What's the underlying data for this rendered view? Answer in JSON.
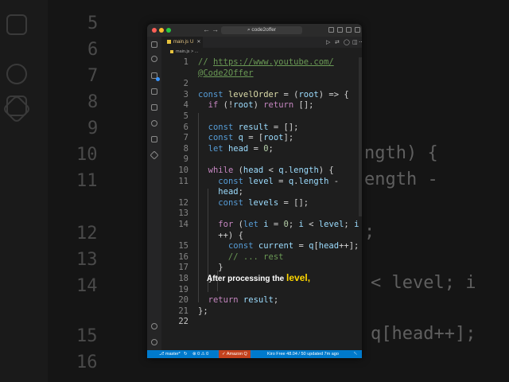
{
  "window": {
    "title": "code2offer",
    "search_text": "⌕ code2offer",
    "traffic_lights": [
      "#ff5f57",
      "#febc2e",
      "#28c840"
    ]
  },
  "tab": {
    "name": "main.js",
    "modified": "U",
    "close": "✕"
  },
  "breadcrumb": "main.js > ...",
  "editor": {
    "lines": [
      {
        "n": "1",
        "t": "// https://www.youtube.com/"
      },
      {
        "n": "",
        "t": "@Code2Offer"
      },
      {
        "n": "2",
        "t": ""
      },
      {
        "n": "3",
        "t": "const levelOrder = (root) => {"
      },
      {
        "n": "4",
        "t": "  if (!root) return [];"
      },
      {
        "n": "5",
        "t": ""
      },
      {
        "n": "6",
        "t": "  const result = [];"
      },
      {
        "n": "7",
        "t": "  const q = [root];"
      },
      {
        "n": "8",
        "t": "  let head = 0;"
      },
      {
        "n": "9",
        "t": ""
      },
      {
        "n": "10",
        "t": "  while (head < q.length) {"
      },
      {
        "n": "11",
        "t": "    const level = q.length -"
      },
      {
        "n": "",
        "t": "    head;"
      },
      {
        "n": "12",
        "t": "    const levels = [];"
      },
      {
        "n": "13",
        "t": ""
      },
      {
        "n": "14",
        "t": "    for (let i = 0; i < level; i"
      },
      {
        "n": "",
        "t": "    ++) {"
      },
      {
        "n": "15",
        "t": "      const current = q[head++];"
      },
      {
        "n": "16",
        "t": "      // ... rest"
      },
      {
        "n": "17",
        "t": "    }"
      },
      {
        "n": "18",
        "t": "  }"
      },
      {
        "n": "19",
        "t": ""
      },
      {
        "n": "20",
        "t": "  return result;"
      },
      {
        "n": "21",
        "t": "};"
      },
      {
        "n": "22",
        "t": ""
      }
    ]
  },
  "caption": {
    "text": "After processing the ",
    "highlight": "level,"
  },
  "status_bar": {
    "branch": "⎇ master*",
    "sync": "↻",
    "problems": "⊗ 0 ⚠ 0",
    "amazon_q": "✓ Amazon Q",
    "kiro": "Kiro Free 48.04 / 50 updated 7m ago",
    "bell": "␇"
  },
  "background": {
    "numbers": [
      "5",
      "6",
      "7",
      "8",
      "9",
      "10",
      "11",
      "12",
      "13",
      "14",
      "15",
      "16"
    ],
    "fragments": [
      "ngth) {",
      "ength -",
      ";",
      "< level; i",
      "q[head++];"
    ]
  }
}
